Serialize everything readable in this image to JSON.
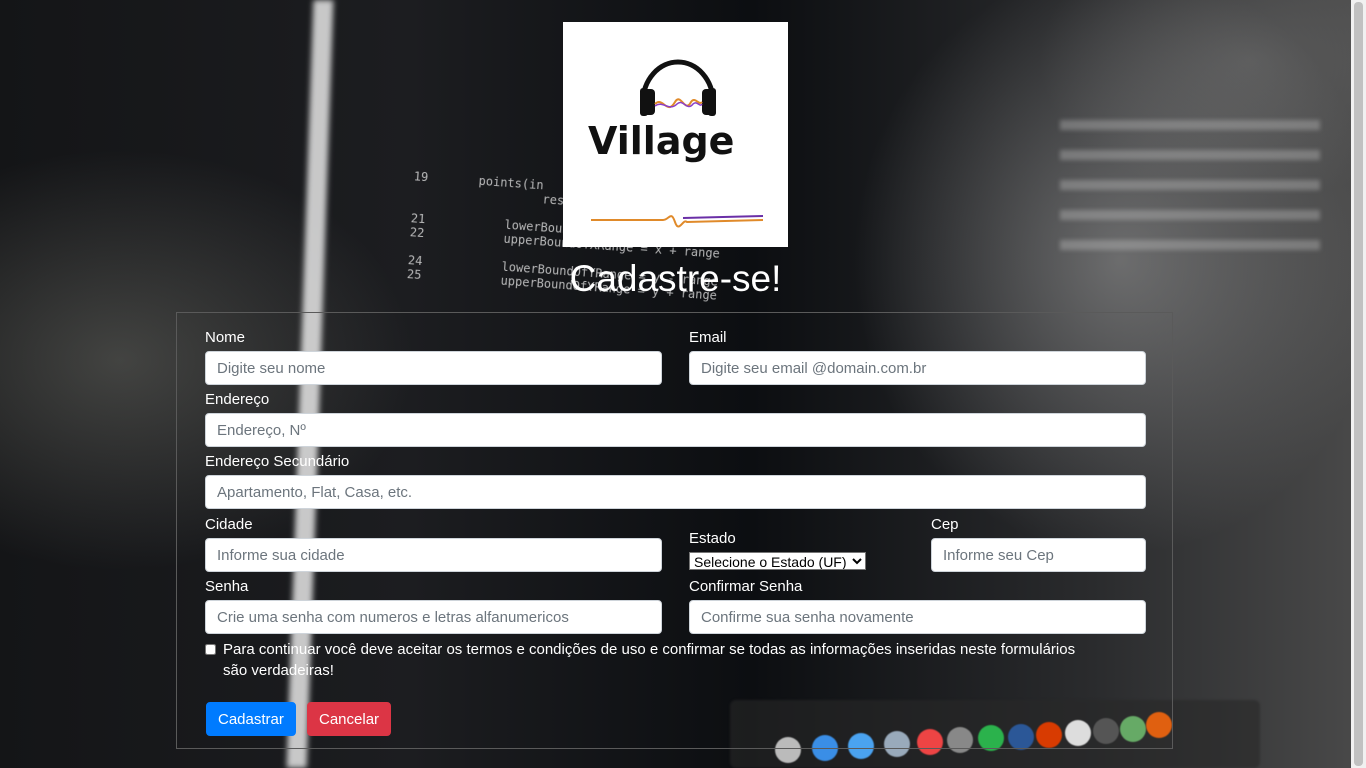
{
  "logo": {
    "brand_text": "Village"
  },
  "page_title": "Cadastre-se!",
  "form": {
    "nome": {
      "label": "Nome",
      "placeholder": "Digite seu nome"
    },
    "email": {
      "label": "Email",
      "placeholder": "Digite seu email @domain.com.br"
    },
    "endereco": {
      "label": "Endereço",
      "placeholder": "Endereço, Nº"
    },
    "endereco2": {
      "label": "Endereço Secundário",
      "placeholder": "Apartamento, Flat, Casa, etc."
    },
    "cidade": {
      "label": "Cidade",
      "placeholder": "Informe sua cidade"
    },
    "estado": {
      "label": "Estado",
      "selected": "Selecione o Estado (UF)"
    },
    "cep": {
      "label": "Cep",
      "placeholder": "Informe seu Cep"
    },
    "senha": {
      "label": "Senha",
      "placeholder": "Crie uma senha com numeros e letras alfanumericos"
    },
    "confirmar_senha": {
      "label": "Confirmar Senha",
      "placeholder": "Confirme sua senha novamente"
    },
    "terms_text": "Para continuar você deve aceitar os termos e condições de uso e confirmar se todas as informações inseridas neste formulários são verdadeiras!",
    "submit_label": "Cadastrar",
    "cancel_label": "Cancelar"
  },
  "colors": {
    "primary": "#007bff",
    "danger": "#dc3545",
    "title_text": "#ffffff"
  }
}
